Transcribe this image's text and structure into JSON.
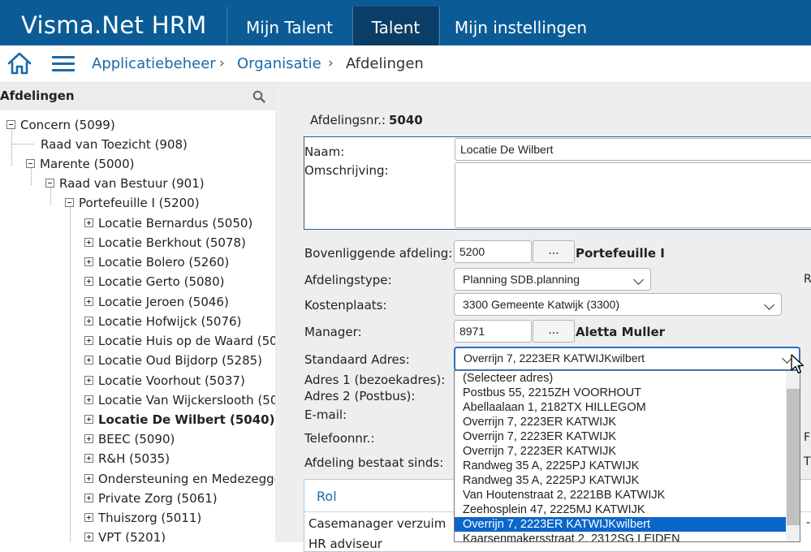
{
  "app": {
    "title": "Visma.Net HRM"
  },
  "nav": {
    "tabs": [
      {
        "label": "Mijn Talent"
      },
      {
        "label": "Talent"
      },
      {
        "label": "Mijn instellingen"
      }
    ]
  },
  "breadcrumb": {
    "items": [
      "Applicatiebeheer",
      "Organisatie",
      "Afdelingen"
    ],
    "separator": "›"
  },
  "sidebar": {
    "title": "Afdelingen",
    "tree": [
      {
        "label": "Concern (5099)"
      },
      {
        "label": "Raad van Toezicht (908)"
      },
      {
        "label": "Marente (5000)"
      },
      {
        "label": "Raad van Bestuur (901)"
      },
      {
        "label": "Portefeuille I (5200)"
      },
      {
        "label": "Locatie Bernardus (5050)"
      },
      {
        "label": "Locatie Berkhout (5078)"
      },
      {
        "label": "Locatie Bolero (5260)"
      },
      {
        "label": "Locatie Gerto (5080)"
      },
      {
        "label": "Locatie Jeroen (5046)"
      },
      {
        "label": "Locatie Hofwijck (5076)"
      },
      {
        "label": "Locatie Huis op de Waard (50"
      },
      {
        "label": "Locatie Oud Bijdorp (5285)"
      },
      {
        "label": "Locatie Voorhout (5037)"
      },
      {
        "label": "Locatie Van Wijckerslooth (50"
      },
      {
        "label": "Locatie De Wilbert (5040)"
      },
      {
        "label": "BEEC (5090)"
      },
      {
        "label": "R&H (5035)"
      },
      {
        "label": "Ondersteuning en Medezegge"
      },
      {
        "label": "Private Zorg (5061)"
      },
      {
        "label": "Thuiszorg (5011)"
      },
      {
        "label": "VPT (5201)"
      }
    ]
  },
  "form": {
    "afdelingsnr_label": "Afdelingsnr.:",
    "afdelingsnr_value": "5040",
    "naam_label": "Naam:",
    "naam_value": "Locatie De Wilbert",
    "omschrijving_label": "Omschrijving:",
    "bovenliggende_label": "Bovenliggende afdeling:",
    "bovenliggende_value": "5200",
    "bovenliggende_name": "Portefeuille I",
    "browse_label": "...",
    "afdelingstype_label": "Afdelingstype:",
    "afdelingstype_value": "Planning SDB.planning",
    "afdelingstype_edge": "R",
    "kostenplaats_label": "Kostenplaats:",
    "kostenplaats_value": "3300 Gemeente Katwijk (3300)",
    "manager_label": "Manager:",
    "manager_value": "8971",
    "manager_name": "Aletta Muller",
    "adres_label": "Standaard Adres:",
    "adres_value": "Overrijn 7, 2223ER KATWIJKwilbert",
    "adres1_label": "Adres 1 (bezoekadres):",
    "adres2_label": "Adres 2 (Postbus):",
    "email_label": "E-mail:",
    "telefoon_label": "Telefoonnr.:",
    "telefoon_edge": "F",
    "bestaat_label": "Afdeling bestaat sinds:",
    "bestaat_edge": "T"
  },
  "roles": {
    "header": "Rol",
    "rows": [
      "Casemanager verzuim",
      "HR adviseur"
    ],
    "edge": "-"
  },
  "address_dropdown": {
    "options": [
      "(Selecteer adres)",
      "Postbus 55, 2215ZH VOORHOUT",
      "Abellaalaan 1, 2182TX HILLEGOM",
      "Overrijn 7, 2223ER KATWIJK",
      "Overrijn 7, 2223ER KATWIJK",
      "Overrijn 7, 2223ER KATWIJK",
      "Randweg 35 A, 2225PJ KATWIJK",
      "Randweg 35 A, 2225PJ KATWIJK",
      "Van Houtenstraat 2, 2221BB KATWIJK",
      "Zeehosplein 47, 2225MJ KATWIJK",
      "Overrijn 7, 2223ER KATWIJKwilbert",
      "Kaarsenmakersstraat 2, 2312SG LEIDEN"
    ],
    "selected_index": 10
  },
  "colors": {
    "topbar": "#0b5c96",
    "active_tab": "#0a3e66",
    "link": "#1a6aa8",
    "selection": "#0a66c9"
  },
  "icons": [
    "home-icon",
    "hamburger-menu-icon",
    "search-icon",
    "chevron-down-icon",
    "mouse-cursor-icon"
  ]
}
